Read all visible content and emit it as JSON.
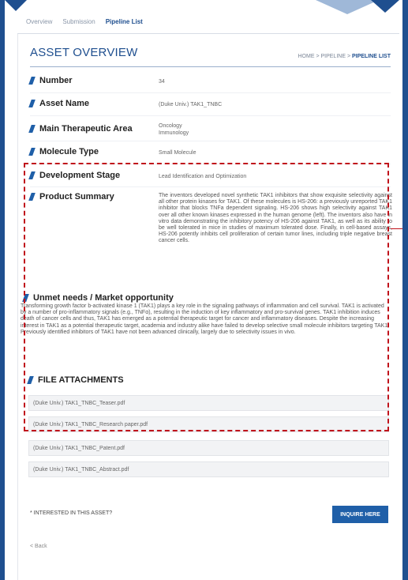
{
  "tabs": {
    "overview": "Overview",
    "submission": "Submission",
    "pipeline": "Pipeline List"
  },
  "header": {
    "title": "ASSET OVERVIEW",
    "breadcrumb": {
      "home": "HOME",
      "sep1": " > ",
      "pipeline": "PIPELINE",
      "sep2": " > ",
      "current": "PIPELINE LIST"
    }
  },
  "asset": {
    "number": {
      "label": "Number",
      "value": "34"
    },
    "name": {
      "label": "Asset Name",
      "value": "(Duke Univ.) TAK1_TNBC"
    },
    "therapeutic": {
      "label": "Main Therapeutic Area",
      "line1": "Oncology",
      "line2": "Immunology"
    },
    "molecule": {
      "label": "Molecule Type",
      "value": "Small Molecule"
    },
    "stage": {
      "label": "Development Stage",
      "value": "Lead Identification and Optimization"
    },
    "summary": {
      "label": "Product Summary",
      "text": "The inventors developed novel synthetic TAK1 inhibitors that show exquisite selectivity against all other protein kinases for TAK1. Of these molecules is HS-206: a previously unreported TAK1 inhibitor that blocks TNFa dependent signaling. HS-206 shows high selectivity against TAK1 over all other known kinases expressed in the human genome (left). The inventors also have in vitro data demonstrating the inhibitory potency of HS-206 against TAK1, as well as its ability to be well tolerated in mice in studies of maximum tolerated dose. Finally, in cell-based assays, HS-206 potently inhibits cell proliferation of certain tumor lines, including triple negative breast cancer cells."
    }
  },
  "unmet": {
    "title": "Unmet needs / Market opportunity",
    "text": "Transforming growth factor b-activated kinase 1 (TAK1) plays a key role in the signaling pathways of inflammation and cell survival. TAK1 is activated by a number of pro-inflammatory signals (e.g., TNFα), resulting in the induction of key inflammatory and pro-survival genes. TAK1 inhibition induces death of cancer cells and thus, TAK1 has emerged as a potential therapeutic target for cancer and inflammatory diseases. Despite the increasing interest in TAK1 as a potential therapeutic target, academia and industry alike have failed to develop selective small molecule inhibitors targeting TAK1. Previously identified inhibitors of TAK1 have not been advanced clinically, largely due to selectivity issues in vivo."
  },
  "files": {
    "title": "FILE ATTACHMENTS",
    "items": [
      "(Duke Univ.) TAK1_TNBC_Teaser.pdf",
      "(Duke Univ.) TAK1_TNBC_Research paper.pdf",
      "(Duke Univ.) TAK1_TNBC_Patent.pdf",
      "(Duke Univ.) TAK1_TNBC_Abstract.pdf"
    ]
  },
  "footer": {
    "interest": "* INTERESTED IN THIS ASSET?",
    "inquire": "INQUIRE HERE",
    "back": "< Back"
  },
  "colors": {
    "accent": "#1f5fa8",
    "highlight": "#c0121b"
  }
}
